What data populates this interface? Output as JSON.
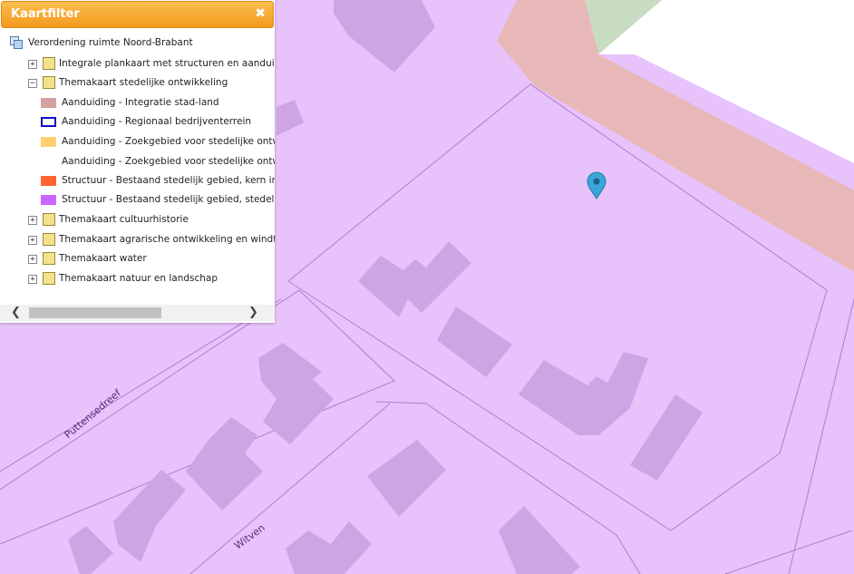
{
  "panel": {
    "title": "Kaartfilter",
    "close_icon": "✖"
  },
  "tree": {
    "root_label": "Verordening ruimte Noord-Brabant",
    "nodes": [
      {
        "label": "Integrale plankaart met structuren en aanduidingen",
        "expanded": false
      },
      {
        "label": "Themakaart stedelijke ontwikkeling",
        "expanded": true
      },
      {
        "label": "Themakaart cultuurhistorie",
        "expanded": false
      },
      {
        "label": "Themakaart agrarische ontwikkeling en windturbines",
        "expanded": false
      },
      {
        "label": "Themakaart water",
        "expanded": false
      },
      {
        "label": "Themakaart natuur en landschap",
        "expanded": false
      }
    ],
    "legend": [
      {
        "label": "Aanduiding - Integratie stad-land",
        "color": "#d4a0a0",
        "style": "fill"
      },
      {
        "label": "Aanduiding - Regionaal bedrijventerrein",
        "color": "#1010c0",
        "style": "outline"
      },
      {
        "label": "Aanduiding - Zoekgebied voor stedelijke ontwikkeling",
        "color": "#ffd070",
        "style": "fill"
      },
      {
        "label": "Aanduiding - Zoekgebied voor stedelijke ontwikkeling",
        "color": "",
        "style": "none"
      },
      {
        "label": "Structuur - Bestaand stedelijk gebied, kern in landelijk gebied",
        "color": "#ff6633",
        "style": "fill"
      },
      {
        "label": "Structuur - Bestaand stedelijk gebied, stedelijk concentratiegebied",
        "color": "#cc66ff",
        "style": "fill"
      }
    ]
  },
  "scrollbar": {
    "left_arrow": "❮",
    "right_arrow": "❯"
  },
  "map": {
    "streets": [
      "Puttensedreef",
      "Witven"
    ],
    "colors": {
      "urban_area": "#e7c2fb",
      "building": "#cfa4e4",
      "integration_band": "#e8b8b8",
      "green": "#c7dcc0",
      "white": "#ffffff",
      "parcel_line": "#b27cd0",
      "marker": "#3aa6da"
    },
    "marker_icon": "map-pin-icon"
  }
}
